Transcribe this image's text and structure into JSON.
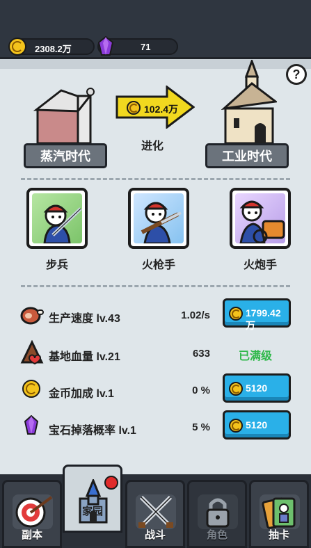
{
  "resources": {
    "coins": "2308.2万",
    "gems": "71"
  },
  "help_label": "?",
  "evolution": {
    "cost": "102.4万",
    "label": "进化",
    "from_era": "蒸汽时代",
    "to_era": "工业时代"
  },
  "units": [
    {
      "name": "步兵"
    },
    {
      "name": "火枪手"
    },
    {
      "name": "火炮手"
    }
  ],
  "upgrades": [
    {
      "label": "生产速度 lv.43",
      "value": "1.02/s",
      "cost": "1799.42万",
      "icon": "meat-icon"
    },
    {
      "label": "基地血量 lv.21",
      "value": "633",
      "status": "已满级",
      "icon": "tent-heart-icon"
    },
    {
      "label": "金币加成 lv.1",
      "value": "0 %",
      "cost": "5120",
      "icon": "coin-icon"
    },
    {
      "label": "宝石掉落概率 lv.1",
      "value": "5 %",
      "cost": "5120",
      "icon": "gem-icon"
    }
  ],
  "nav": [
    {
      "label": "副本",
      "icon": "target-icon"
    },
    {
      "label": "家园",
      "icon": "castle-icon"
    },
    {
      "label": "战斗",
      "icon": "crossed-swords-icon"
    },
    {
      "label": "角色",
      "icon": "lock-icon"
    },
    {
      "label": "抽卡",
      "icon": "cards-icon"
    }
  ],
  "colors": {
    "accent_blue": "#2ab0e8",
    "coin": "#f3c31c",
    "gem": "#8a3bd8",
    "maxed": "#2fb84a",
    "badge": "#e12b2b"
  }
}
